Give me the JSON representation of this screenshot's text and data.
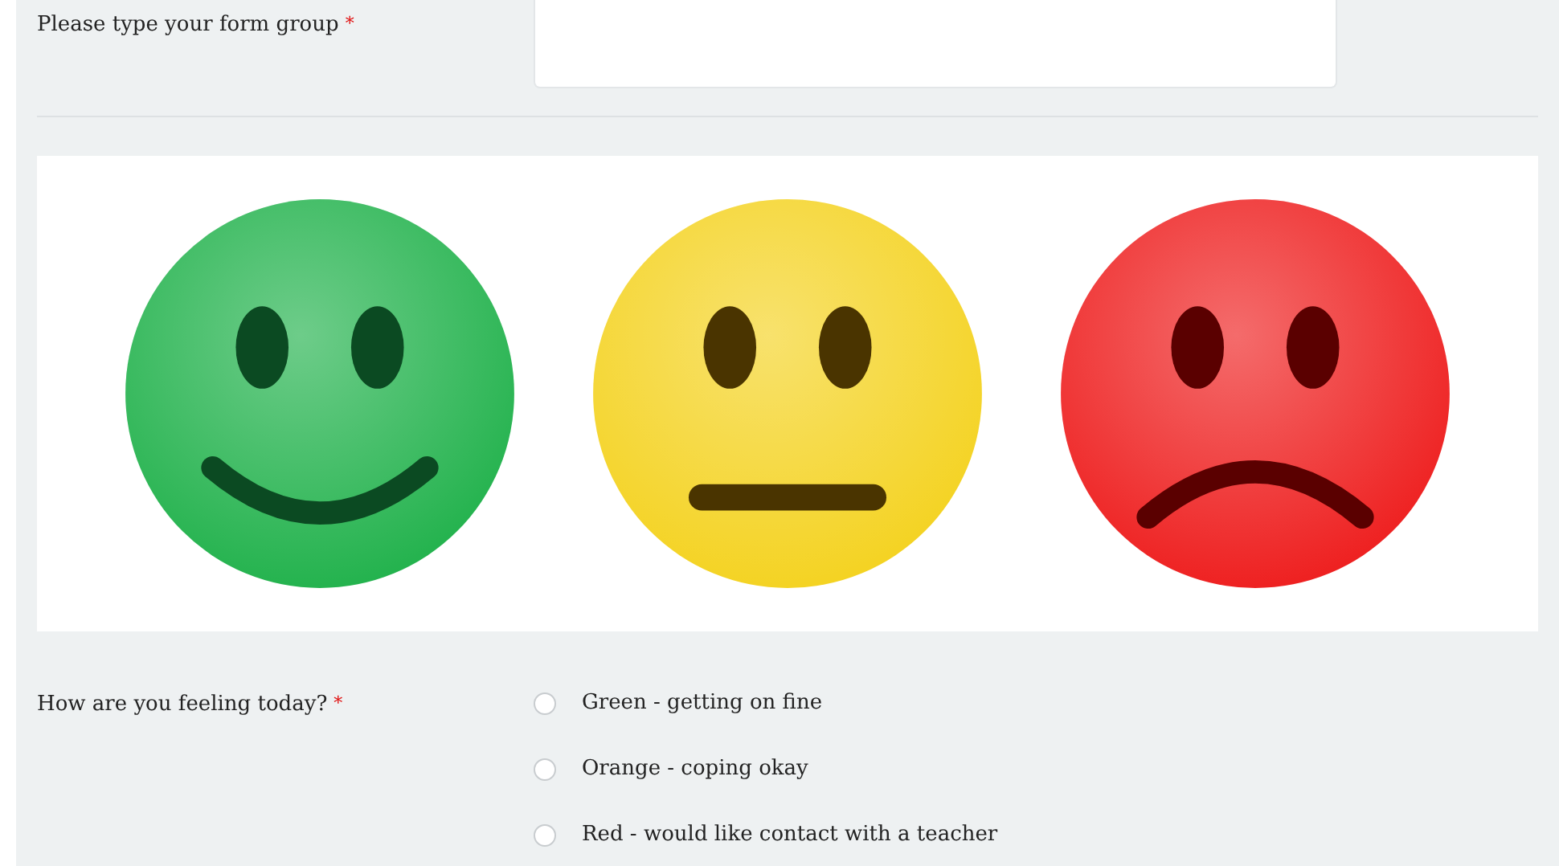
{
  "form_group": {
    "label": "Please type your form group",
    "required_mark": "*"
  },
  "mood_image": {
    "faces": [
      {
        "kind": "happy",
        "color": "#1fb14a"
      },
      {
        "kind": "neutral",
        "color": "#f4d21e"
      },
      {
        "kind": "sad",
        "color": "#ee1c1c"
      }
    ]
  },
  "feeling": {
    "label": "How are you feeling today?",
    "required_mark": "*",
    "options": [
      {
        "label": "Green - getting on fine",
        "selected": false
      },
      {
        "label": "Orange - coping okay",
        "selected": false
      },
      {
        "label": "Red - would like contact with a teacher",
        "selected": false
      }
    ]
  }
}
